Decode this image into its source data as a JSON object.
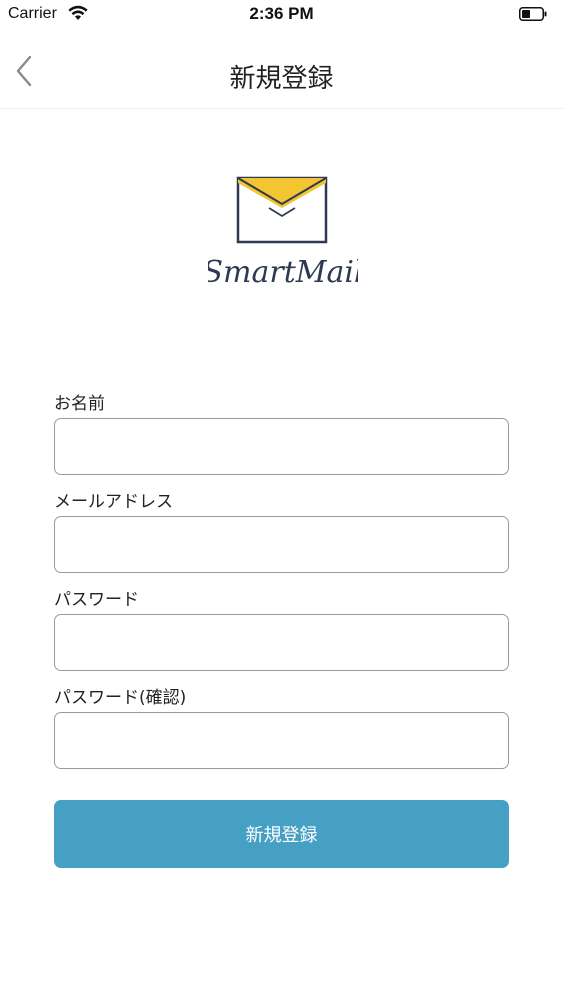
{
  "status_bar": {
    "carrier": "Carrier",
    "time": "2:36 PM"
  },
  "nav": {
    "title": "新規登録",
    "back_icon": "chevron-left-icon"
  },
  "logo": {
    "wordmark": "SmartMail",
    "icon": "envelope-icon",
    "accent_color": "#f2c531",
    "stroke_color": "#2f3a52"
  },
  "form": {
    "fields": [
      {
        "label": "お名前",
        "value": "",
        "placeholder": ""
      },
      {
        "label": "メールアドレス",
        "value": "",
        "placeholder": ""
      },
      {
        "label": "パスワード",
        "value": "",
        "placeholder": ""
      },
      {
        "label": "パスワード(確認)",
        "value": "",
        "placeholder": ""
      }
    ],
    "submit_label": "新規登録",
    "submit_color": "#45a0c3"
  }
}
